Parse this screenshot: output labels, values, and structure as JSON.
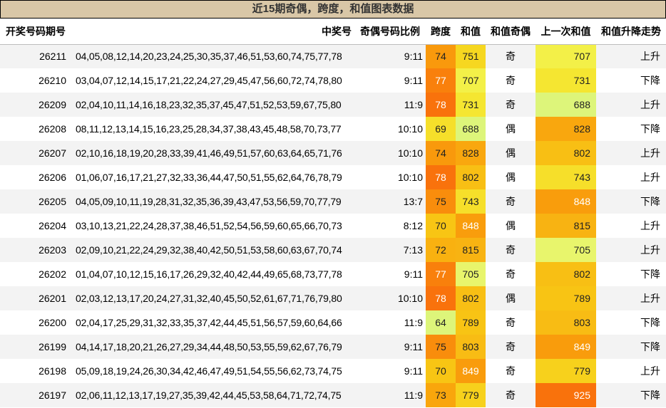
{
  "title": "近15期奇偶，跨度，和值图表数据",
  "headers": {
    "issue": "开奖号码期号",
    "numbers": "中奖号",
    "ratio": "奇偶号码比例",
    "span": "跨度",
    "sum": "和值",
    "sum_parity": "和值奇偶",
    "prev_sum": "上一次和值",
    "trend": "和值升降走势"
  },
  "colors": {
    "title_bg": "#d9c7a7",
    "span_scale": {
      "64": "#ddf57a",
      "69": "#f6df2a",
      "70": "#f8c514",
      "72": "#f9b110",
      "73": "#f9a60c",
      "74": "#f9990c",
      "75": "#f98d0c",
      "77": "#f9800c",
      "78": "#f9720c"
    },
    "sum_prev_scale": {
      "688": "#ddf57a",
      "705": "#e8f56c",
      "707": "#f3f048",
      "731": "#f5e631",
      "743": "#f6df2a",
      "751": "#f6d720",
      "779": "#f7d11c",
      "789": "#f8c414",
      "802": "#f8bf14",
      "803": "#f8bc14",
      "815": "#f8b312",
      "828": "#f9a70e",
      "848": "#f99d0c",
      "849": "#f99c0c",
      "925": "#f9720c"
    }
  },
  "rows": [
    {
      "issue": "26211",
      "numbers": "04,05,08,12,14,20,23,24,25,30,35,37,46,51,53,60,74,75,77,78",
      "ratio": "9:11",
      "span": "74",
      "sum": "751",
      "sum_parity": "奇",
      "prev_sum": "707",
      "trend": "上升"
    },
    {
      "issue": "26210",
      "numbers": "03,04,07,12,14,15,17,21,22,24,27,29,45,47,56,60,72,74,78,80",
      "ratio": "9:11",
      "span": "77",
      "sum": "707",
      "sum_parity": "奇",
      "prev_sum": "731",
      "trend": "下降"
    },
    {
      "issue": "26209",
      "numbers": "02,04,10,11,14,16,18,23,32,35,37,45,47,51,52,53,59,67,75,80",
      "ratio": "11:9",
      "span": "78",
      "sum": "731",
      "sum_parity": "奇",
      "prev_sum": "688",
      "trend": "上升"
    },
    {
      "issue": "26208",
      "numbers": "08,11,12,13,14,15,16,23,25,28,34,37,38,43,45,48,58,70,73,77",
      "ratio": "10:10",
      "span": "69",
      "sum": "688",
      "sum_parity": "偶",
      "prev_sum": "828",
      "trend": "下降"
    },
    {
      "issue": "26207",
      "numbers": "02,10,16,18,19,20,28,33,39,41,46,49,51,57,60,63,64,65,71,76",
      "ratio": "10:10",
      "span": "74",
      "sum": "828",
      "sum_parity": "偶",
      "prev_sum": "802",
      "trend": "上升"
    },
    {
      "issue": "26206",
      "numbers": "01,06,07,16,17,21,27,32,33,36,44,47,50,51,55,62,64,76,78,79",
      "ratio": "10:10",
      "span": "78",
      "sum": "802",
      "sum_parity": "偶",
      "prev_sum": "743",
      "trend": "上升"
    },
    {
      "issue": "26205",
      "numbers": "04,05,09,10,11,19,28,31,32,35,36,39,43,47,53,56,59,70,77,79",
      "ratio": "13:7",
      "span": "75",
      "sum": "743",
      "sum_parity": "奇",
      "prev_sum": "848",
      "trend": "下降"
    },
    {
      "issue": "26204",
      "numbers": "03,10,13,21,22,24,28,37,38,46,51,52,54,56,59,60,65,66,70,73",
      "ratio": "8:12",
      "span": "70",
      "sum": "848",
      "sum_parity": "偶",
      "prev_sum": "815",
      "trend": "上升"
    },
    {
      "issue": "26203",
      "numbers": "02,09,10,21,22,24,29,32,38,40,42,50,51,53,58,60,63,67,70,74",
      "ratio": "7:13",
      "span": "72",
      "sum": "815",
      "sum_parity": "奇",
      "prev_sum": "705",
      "trend": "上升"
    },
    {
      "issue": "26202",
      "numbers": "01,04,07,10,12,15,16,17,26,29,32,40,42,44,49,65,68,73,77,78",
      "ratio": "9:11",
      "span": "77",
      "sum": "705",
      "sum_parity": "奇",
      "prev_sum": "802",
      "trend": "下降"
    },
    {
      "issue": "26201",
      "numbers": "02,03,12,13,17,20,24,27,31,32,40,45,50,52,61,67,71,76,79,80",
      "ratio": "10:10",
      "span": "78",
      "sum": "802",
      "sum_parity": "偶",
      "prev_sum": "789",
      "trend": "上升"
    },
    {
      "issue": "26200",
      "numbers": "02,04,17,25,29,31,32,33,35,37,42,44,45,51,56,57,59,60,64,66",
      "ratio": "11:9",
      "span": "64",
      "sum": "789",
      "sum_parity": "奇",
      "prev_sum": "803",
      "trend": "下降"
    },
    {
      "issue": "26199",
      "numbers": "04,14,17,18,20,21,26,27,29,34,44,48,50,53,55,59,62,67,76,79",
      "ratio": "9:11",
      "span": "75",
      "sum": "803",
      "sum_parity": "奇",
      "prev_sum": "849",
      "trend": "下降"
    },
    {
      "issue": "26198",
      "numbers": "05,09,18,19,24,26,30,34,42,46,47,49,51,54,55,56,62,73,74,75",
      "ratio": "9:11",
      "span": "70",
      "sum": "849",
      "sum_parity": "奇",
      "prev_sum": "779",
      "trend": "上升"
    },
    {
      "issue": "26197",
      "numbers": "02,06,11,12,13,17,19,27,35,39,42,44,45,53,58,64,71,72,74,75",
      "ratio": "11:9",
      "span": "73",
      "sum": "779",
      "sum_parity": "奇",
      "prev_sum": "925",
      "trend": "下降"
    }
  ]
}
